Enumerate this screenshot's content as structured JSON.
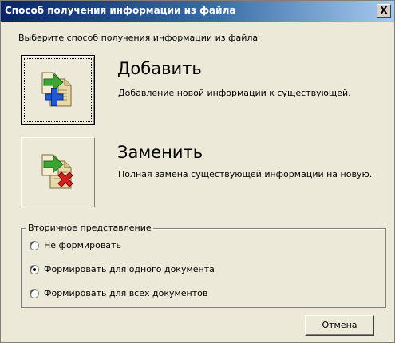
{
  "window": {
    "title": "Способ получения информации из файла",
    "close_glyph": "X"
  },
  "prompt": "Выберите способ получения информации из файла",
  "options": [
    {
      "title": "Добавить",
      "description": "Добавление новой информации к существующей.",
      "icon": "add-documents-icon",
      "focused": true
    },
    {
      "title": "Заменить",
      "description": "Полная замена существующей информации на новую.",
      "icon": "replace-documents-icon",
      "focused": false
    }
  ],
  "secondary": {
    "legend": "Вторичное представление",
    "radios": [
      {
        "label": "Не формировать",
        "checked": false
      },
      {
        "label": "Формировать для одного документа",
        "checked": true
      },
      {
        "label": "Формировать для всех документов",
        "checked": false
      }
    ]
  },
  "buttons": {
    "cancel": "Отмена"
  },
  "colors": {
    "title_gradient_start": "#0a246a",
    "title_gradient_end": "#a6caf0",
    "dialog_background": "#ece9d8",
    "arrow_green": "#3ca532",
    "plus_blue": "#1c5ad6",
    "cross_red": "#d21e1e"
  }
}
